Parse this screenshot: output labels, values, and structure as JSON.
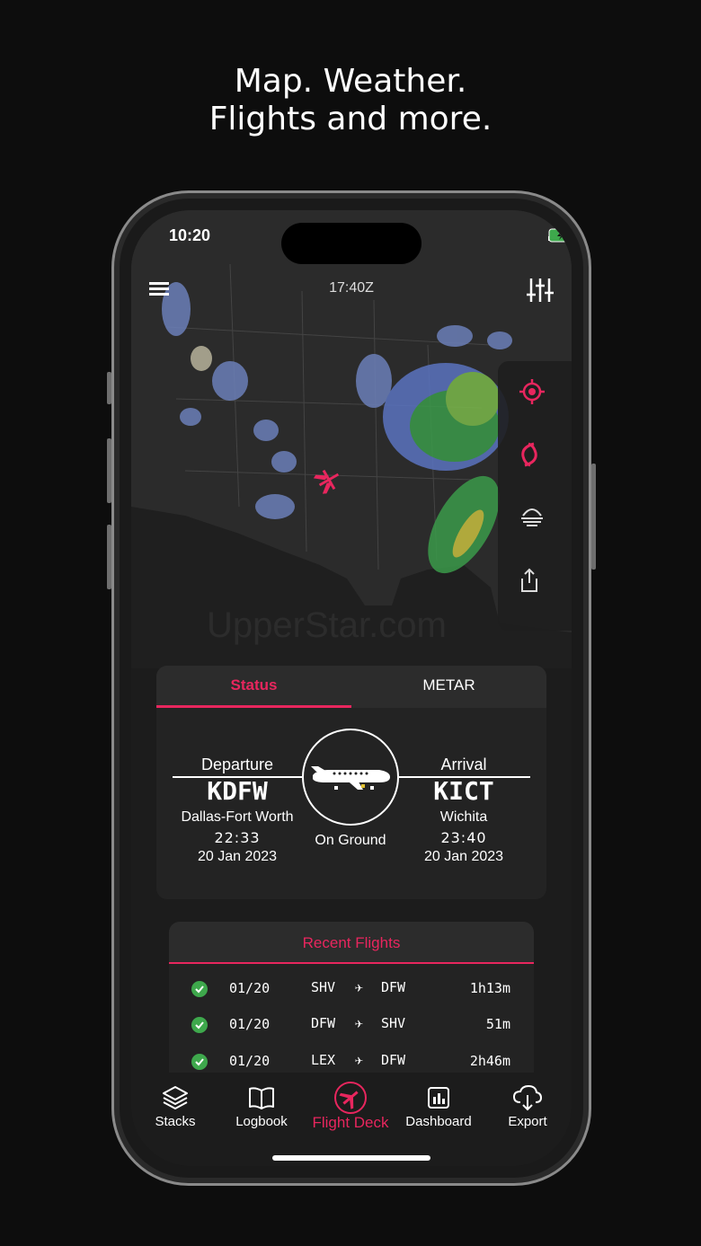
{
  "headline": {
    "line1": "Map. Weather.",
    "line2": "Flights and more."
  },
  "status_bar": {
    "time": "10:20"
  },
  "map": {
    "zulu_time": "17:40Z",
    "watermark": "UpperStar.com"
  },
  "status_card": {
    "tabs": [
      {
        "label": "Status",
        "active": true
      },
      {
        "label": "METAR",
        "active": false
      }
    ],
    "departure": {
      "label": "Departure",
      "code": "KDFW",
      "city": "Dallas-Fort Worth",
      "time": "22:33",
      "date": "20 Jan 2023"
    },
    "arrival": {
      "label": "Arrival",
      "code": "KICT",
      "city": "Wichita",
      "time": "23:40",
      "date": "20 Jan 2023"
    },
    "flight_status": "On Ground"
  },
  "recent_flights": {
    "title": "Recent Flights",
    "rows": [
      {
        "date": "01/20",
        "from": "SHV",
        "to": "DFW",
        "duration": "1h13m"
      },
      {
        "date": "01/20",
        "from": "DFW",
        "to": "SHV",
        "duration": "51m"
      },
      {
        "date": "01/20",
        "from": "LEX",
        "to": "DFW",
        "duration": "2h46m"
      }
    ]
  },
  "tab_bar": {
    "items": [
      {
        "label": "Stacks",
        "icon": "stack-icon"
      },
      {
        "label": "Logbook",
        "icon": "book-icon"
      },
      {
        "label": "Flight Deck",
        "icon": "plane-circle-icon",
        "active": true
      },
      {
        "label": "Dashboard",
        "icon": "chart-icon"
      },
      {
        "label": "Export",
        "icon": "cloud-download-icon"
      }
    ]
  },
  "colors": {
    "accent": "#e8265e",
    "success": "#3ea84c",
    "background": "#0d0d0d"
  }
}
